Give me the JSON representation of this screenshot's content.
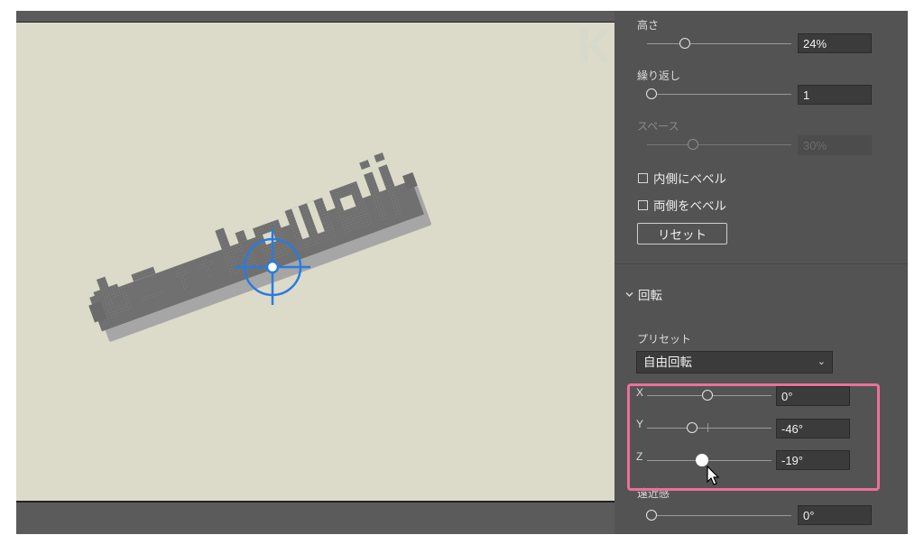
{
  "watermark": "KAKETA",
  "artwork": {
    "text": "ねこきゃkawaii"
  },
  "panel": {
    "height": {
      "label": "高さ",
      "value": "24%",
      "level": 0.24
    },
    "repeat": {
      "label": "繰り返し",
      "value": "1"
    },
    "space": {
      "label": "スペース",
      "value": "30%"
    },
    "bevel_inside": {
      "label": "内側にベベル",
      "checked": false
    },
    "bevel_both": {
      "label": "両側をベベル",
      "checked": false
    },
    "reset_button": "リセット",
    "rotation_section": {
      "label": "回転",
      "chevron": "chevron-down-icon"
    },
    "preset": {
      "label": "プリセット",
      "value": "自由回転"
    },
    "x": {
      "label": "X",
      "value": "0°",
      "degrees": 0
    },
    "y": {
      "label": "Y",
      "value": "-46°",
      "degrees": -46
    },
    "z": {
      "label": "Z",
      "value": "-19°",
      "degrees": -19
    },
    "perspective": {
      "label": "遠近感",
      "value": "0°"
    }
  },
  "colors": {
    "highlight": "#ec6f9c",
    "artboard": "#dcdac9",
    "panel": "#535353",
    "gizmo": "#2a7be0"
  }
}
